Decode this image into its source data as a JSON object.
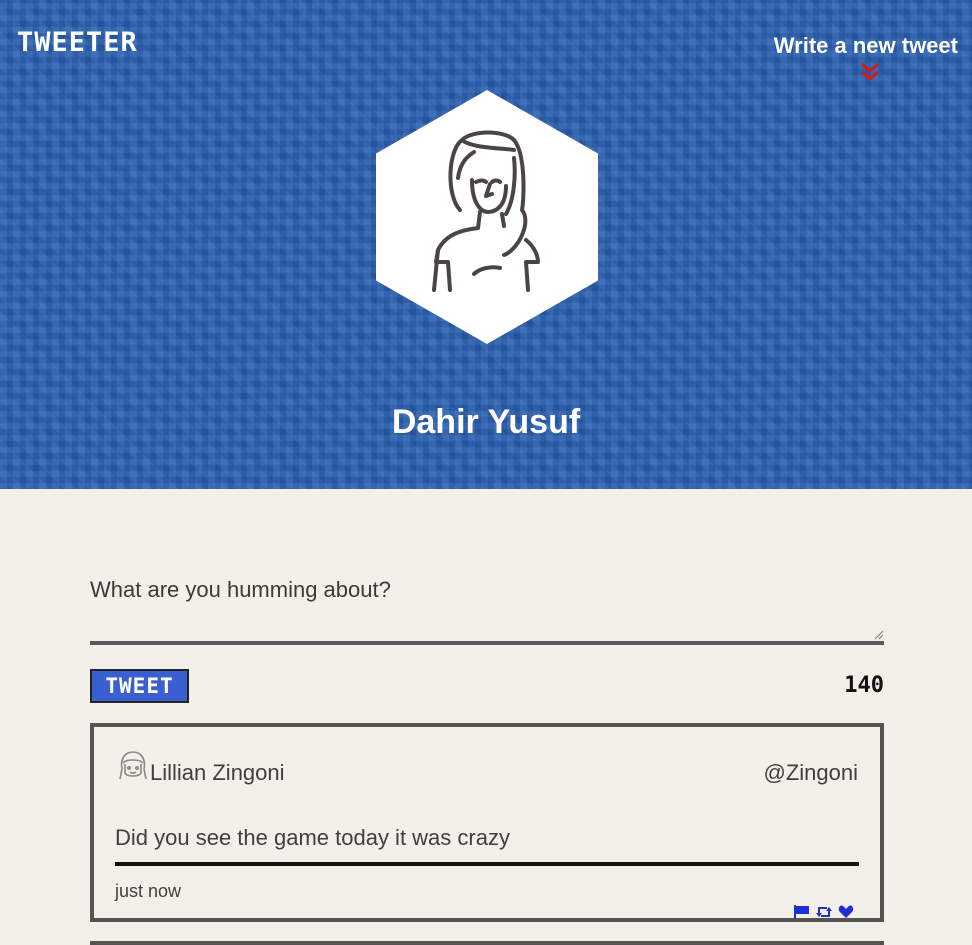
{
  "header": {
    "logo": "TWEETER",
    "compose_link": "Write a new tweet",
    "compose_icon": "double-chevron-down-icon",
    "accent_color": "#d11a1a",
    "background_color": "#2a5fb0"
  },
  "profile": {
    "avatar_icon": "woman-avatar-icon",
    "display_name": "Dahir Yusuf"
  },
  "compose": {
    "placeholder": "What are you humming about?",
    "value": "",
    "submit_label": "TWEET",
    "char_counter": "140",
    "button_color": "#3a5fd0"
  },
  "tweets": [
    {
      "avatar_icon": "face-avatar-icon",
      "name": "Lillian Zingoni",
      "handle": "@Zingoni",
      "body": "Did you see the game today it was crazy",
      "time": "just now",
      "actions": [
        "flag-icon",
        "retweet-icon",
        "heart-icon"
      ],
      "action_color": "#1f2fd6"
    }
  ]
}
